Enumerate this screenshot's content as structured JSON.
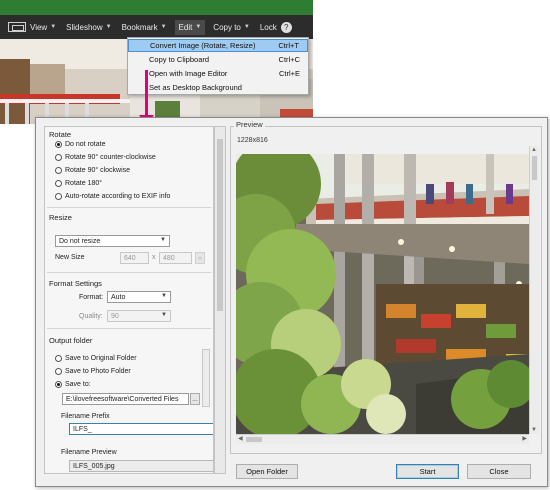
{
  "toolbar": {
    "view": "View",
    "slideshow": "Slideshow",
    "bookmark": "Bookmark",
    "edit": "Edit",
    "copy_to": "Copy to",
    "lock": "Lock"
  },
  "menu": {
    "items": [
      {
        "label": "Convert Image (Rotate, Resize)",
        "shortcut": "Ctrl+T"
      },
      {
        "label": "Copy to Clipboard",
        "shortcut": "Ctrl+C"
      },
      {
        "label": "Open with Image Editor",
        "shortcut": "Ctrl+E"
      },
      {
        "label": "Set as Desktop Background",
        "shortcut": ""
      }
    ]
  },
  "dialog": {
    "rotate": {
      "title": "Rotate",
      "options": [
        "Do not rotate",
        "Rotate 90° counter-clockwise",
        "Rotate 90° clockwise",
        "Rotate 180°",
        "Auto-rotate according to EXIF info"
      ],
      "selected_index": 0
    },
    "resize": {
      "title": "Resize",
      "mode": "Do not resize",
      "new_size_label": "New Size",
      "width": "640",
      "x_sep": "x",
      "height": "480"
    },
    "format": {
      "title": "Format Settings",
      "format_label": "Format:",
      "format_value": "Auto",
      "quality_label": "Quality:",
      "quality_value": "90"
    },
    "output": {
      "title": "Output folder",
      "options": [
        "Save to Original Folder",
        "Save to Photo Folder",
        "Save to:"
      ],
      "selected_index": 2,
      "path": "E:\\ilovefreesoftware\\Converted Files",
      "browse": "...",
      "prefix_label": "Filename Prefix",
      "prefix_value": "ILFS_",
      "preview_label": "Filename Preview",
      "preview_value": "ILFS_005.jpg"
    },
    "preview": {
      "title": "Preview",
      "dimensions": "1228x816"
    },
    "buttons": {
      "open_folder": "Open Folder",
      "start": "Start",
      "close": "Close"
    }
  },
  "colors": {
    "accent_arrow": "#e2007a",
    "menu_highlight": "#9ecbf1",
    "toolbar_bg": "#2c2c2c",
    "title_bar": "#2e7d32"
  }
}
